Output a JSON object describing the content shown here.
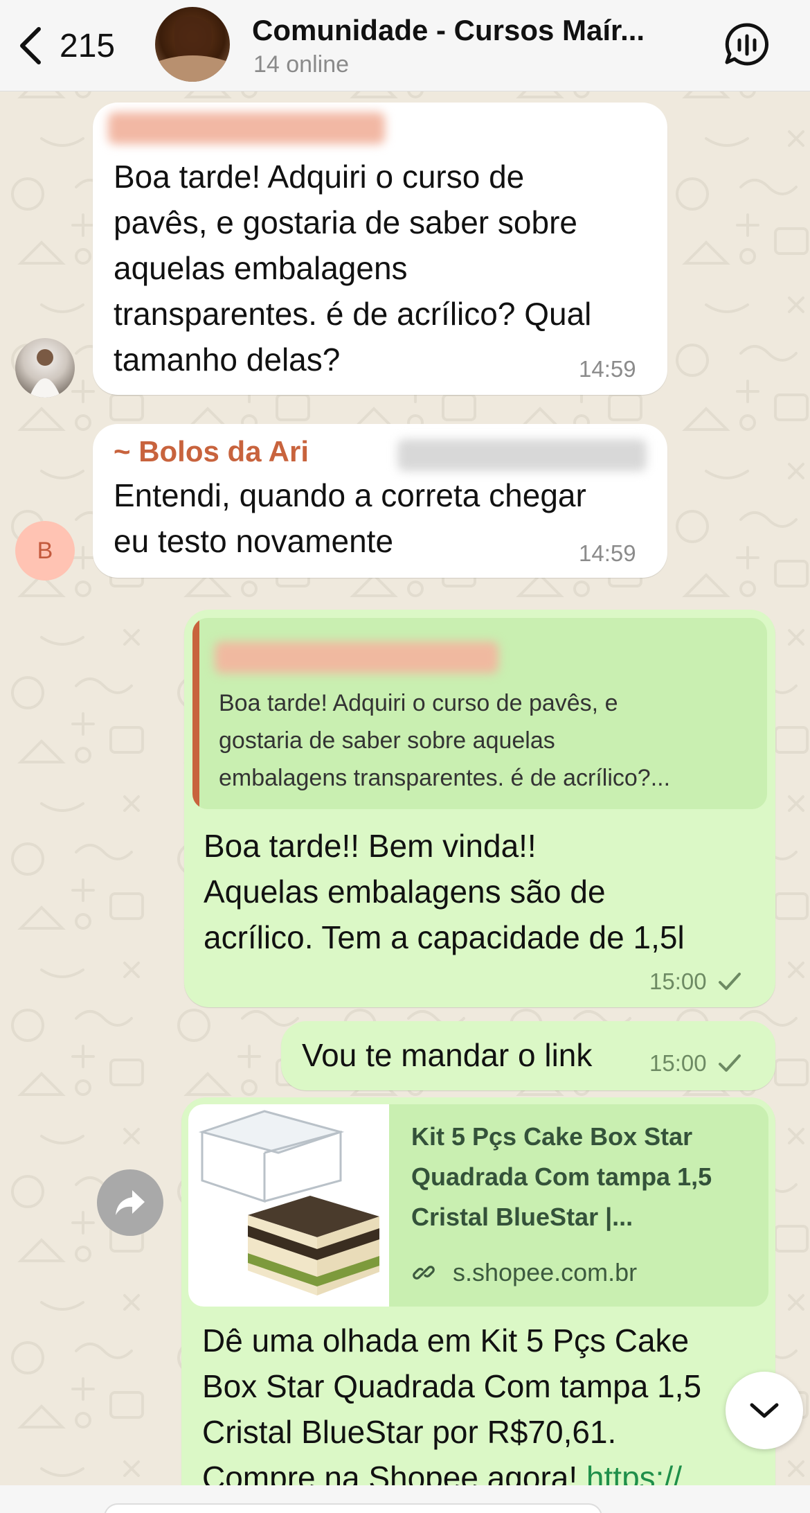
{
  "header": {
    "back_count": "215",
    "title": "Comunidade - Cursos Maír...",
    "subtitle": "14 online",
    "call_icon": "voice-chat-icon"
  },
  "messages": [
    {
      "direction": "incoming",
      "text_lines": [
        "Boa tarde! Adquiri o curso de",
        "pavês, e gostaria de saber sobre",
        "aquelas embalagens",
        "transparentes. é de acrílico? Qual",
        "tamanho delas?"
      ],
      "time": "14:59"
    },
    {
      "direction": "incoming",
      "sender": "~ Bolos da Ari",
      "avatar_letter": "B",
      "text_lines": [
        "Entendi, quando a correta chegar",
        "eu testo novamente"
      ],
      "time": "14:59"
    },
    {
      "direction": "outgoing",
      "quote_lines": [
        "Boa tarde! Adquiri o curso de pavês, e",
        "gostaria de saber sobre aquelas",
        "embalagens transparentes. é de acrílico?..."
      ],
      "text_lines": [
        "Boa tarde!! Bem vinda!!",
        "Aquelas embalagens são de",
        "acrílico. Tem a capacidade de 1,5l"
      ],
      "time": "15:00"
    },
    {
      "direction": "outgoing",
      "text": "Vou te mandar o link",
      "time": "15:00"
    },
    {
      "direction": "outgoing",
      "preview_title_lines": [
        "Kit 5 Pçs Cake Box Star",
        "Quadrada Com tampa 1,5",
        "Cristal BlueStar |..."
      ],
      "preview_domain": "s.shopee.com.br",
      "text_lines": [
        "Dê uma olhada em Kit 5 Pçs Cake",
        "Box Star Quadrada Com tampa 1,5",
        "Cristal BlueStar por R$70,61.",
        "Compre na Shopee agora! "
      ],
      "link_text": "https://"
    }
  ],
  "colors": {
    "outgoing_bubble": "#dbf8c6",
    "incoming_bubble": "#ffffff",
    "sender_name": "#c8633d",
    "wallpaper": "#efe9dd"
  }
}
